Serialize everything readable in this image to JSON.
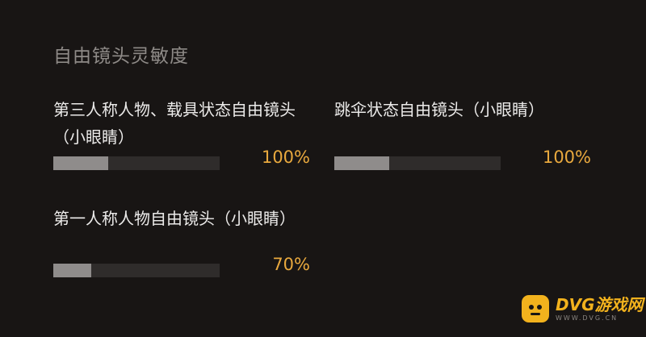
{
  "section": {
    "title": "自由镜头灵敏度"
  },
  "settings": [
    {
      "label": "第三人称人物、载具状态自由镜头\n（小眼睛）",
      "value_text": "100%",
      "fill_percent": 33
    },
    {
      "label": "跳伞状态自由镜头（小眼睛）",
      "value_text": "100%",
      "fill_percent": 33
    },
    {
      "label": "第一人称人物自由镜头（小眼睛）",
      "value_text": "70%",
      "fill_percent": 23
    }
  ],
  "colors": {
    "background": "#181514",
    "title": "#8e8a87",
    "label": "#ecebea",
    "value": "#e9a93e",
    "track": "#2f2c2b",
    "fill": "#8f8c8b"
  },
  "watermark": {
    "icon": "gamepad-face-icon",
    "main": "DVG游戏网",
    "sub": "WWW.DVG.CN"
  }
}
